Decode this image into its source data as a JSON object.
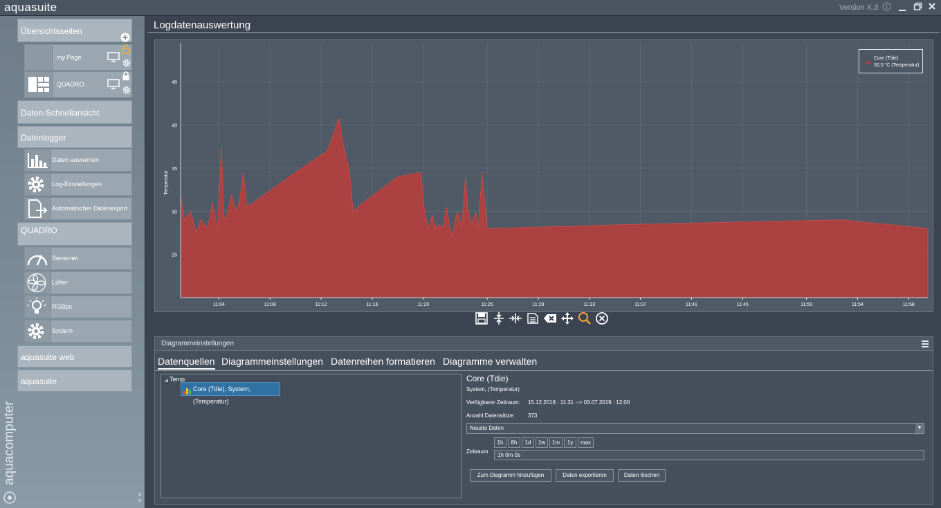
{
  "app": {
    "name": "aquasuite",
    "version": "Version X.3",
    "brand_vertical": "aquacomputer"
  },
  "sidebar": {
    "overview": "Übersichtsseiten",
    "pages": [
      {
        "label": "my Page",
        "locked": false
      },
      {
        "label": "QUADRO",
        "locked": true
      }
    ],
    "quickview": "Daten-Schnellansicht",
    "datalogger": "Datenlogger",
    "datalogger_items": [
      {
        "label": "Daten auswerten",
        "icon": "bar-chart-icon"
      },
      {
        "label": "Log-Einstellungen",
        "icon": "gear-icon"
      },
      {
        "label": "Automatischer Datenexport",
        "icon": "export-icon"
      }
    ],
    "device": "QUADRO",
    "device_items": [
      {
        "label": "Sensoren",
        "icon": "gauge-icon"
      },
      {
        "label": "Lüfter",
        "icon": "fan-icon"
      },
      {
        "label": "RGBpx",
        "icon": "bulb-icon"
      },
      {
        "label": "System",
        "icon": "gear-icon"
      }
    ],
    "web": "aquasuite web",
    "suite": "aquasuite"
  },
  "main": {
    "title": "Logdatenauswertung"
  },
  "chart_data": {
    "type": "area",
    "title": "",
    "xlabel": "",
    "ylabel": "Temperatur",
    "ylim": [
      20,
      49.5
    ],
    "yticks": [
      25,
      30,
      35,
      40,
      45
    ],
    "xticks": [
      "11:04",
      "11:08",
      "11:12",
      "11:16",
      "11:20",
      "11:25",
      "11:29",
      "11:33",
      "11:37",
      "11:41",
      "11:45",
      "11:50",
      "11:54",
      "11:58"
    ],
    "xlim_min": [
      61.0,
      119.5
    ],
    "grid": true,
    "legend_position": "top-right",
    "color": "#b0403f",
    "series": [
      {
        "name": "Core (Tdie)",
        "legend_value": "32,0 °C (Temperatur)",
        "x": [
          61.0,
          61.3,
          61.8,
          62.2,
          62.6,
          63.1,
          63.5,
          63.9,
          64.2,
          64.4,
          64.7,
          65.0,
          65.3,
          65.6,
          65.9,
          66.2,
          66.7,
          69.5,
          72.5,
          73.4,
          73.7,
          74.0,
          74.2,
          74.5,
          75.3,
          78.0,
          79.8,
          80.1,
          80.4,
          80.7,
          81.0,
          81.2,
          81.5,
          81.8,
          82.1,
          82.3,
          82.5,
          82.7,
          83.0,
          83.3,
          83.5,
          83.8,
          84.1,
          84.3,
          84.6,
          85.0,
          97.0,
          112.8,
          119.5
        ],
        "y": [
          32.0,
          29.0,
          30.0,
          27.5,
          29.0,
          28.0,
          31.0,
          28.0,
          37.5,
          29.0,
          30.0,
          32.0,
          30.0,
          31.0,
          34.5,
          30.5,
          31.0,
          34.0,
          37.0,
          40.8,
          38.0,
          36.0,
          35.0,
          30.0,
          31.0,
          34.0,
          34.5,
          30.0,
          28.0,
          29.5,
          28.0,
          28.5,
          28.0,
          30.5,
          28.0,
          27.0,
          29.0,
          30.0,
          28.0,
          34.0,
          30.0,
          28.5,
          30.0,
          28.0,
          34.5,
          28.0,
          28.5,
          29.0,
          28.0
        ]
      }
    ]
  },
  "toolbar": [
    "save-icon",
    "expand-vertical-icon",
    "expand-horizontal-icon",
    "document-icon",
    "clear-icon",
    "move-icon",
    "zoom-icon",
    "close-circle-icon"
  ],
  "settings": {
    "title": "Diagrammeinstellungen",
    "tabs": [
      "Datenquellen",
      "Diagrammeinstellungen",
      "Datenreihen formatieren",
      "Diagramme verwalten"
    ],
    "tree_root": "Temp",
    "tree_node": "Core (Tdie), System, (Temperatur)",
    "detail": {
      "title": "Core (Tdie)",
      "subtitle": "System, (Temperatur)",
      "range_label": "Verfügbarer Zeitraum:",
      "range_value": "15.12.2018 : 11:31 --> 03.07.2019 : 12:00",
      "count_label": "Anzahl Datensätze:",
      "count_value": "373",
      "select_value": "Neuste Daten",
      "zeitraum_label": "Zeitraum",
      "range_buttons": [
        "1h",
        "8h",
        "1d",
        "1w",
        "1m",
        "1y",
        "max"
      ],
      "zeitraum_value": "1h 0m 0s",
      "actions": [
        "Zum Diagramm hinzufügen",
        "Daten exportieren",
        "Daten löschen"
      ]
    }
  }
}
